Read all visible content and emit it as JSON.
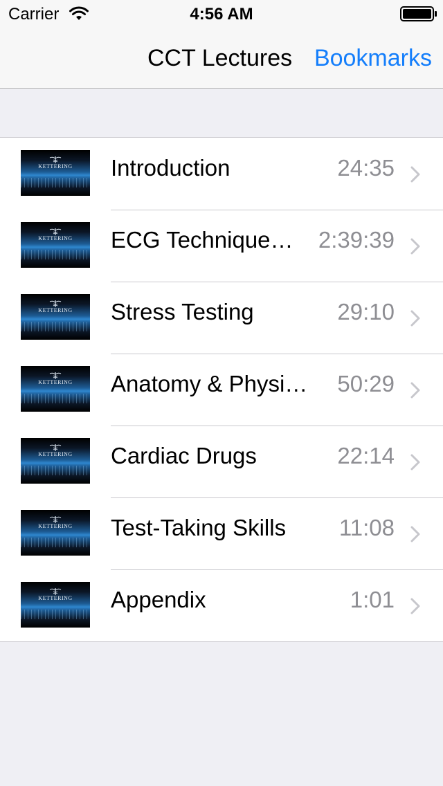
{
  "status_bar": {
    "carrier": "Carrier",
    "time": "4:56 AM",
    "wifi_icon": "wifi-icon",
    "battery_icon": "battery-icon"
  },
  "nav_bar": {
    "title": "CCT Lectures",
    "right_button": "Bookmarks"
  },
  "thumbnail": {
    "logo_text": "KETTERING"
  },
  "lectures": [
    {
      "title": "Introduction",
      "duration": "24:35"
    },
    {
      "title": "ECG Technique…",
      "duration": "2:39:39"
    },
    {
      "title": "Stress Testing",
      "duration": "29:10"
    },
    {
      "title": "Anatomy & Physi…",
      "duration": "50:29"
    },
    {
      "title": "Cardiac Drugs",
      "duration": "22:14"
    },
    {
      "title": "Test-Taking Skills",
      "duration": "11:08"
    },
    {
      "title": "Appendix",
      "duration": "1:01"
    }
  ],
  "colors": {
    "accent": "#147efb",
    "secondary_text": "#8e8e93",
    "background": "#efeff4",
    "chevron": "#c7c7cc"
  }
}
